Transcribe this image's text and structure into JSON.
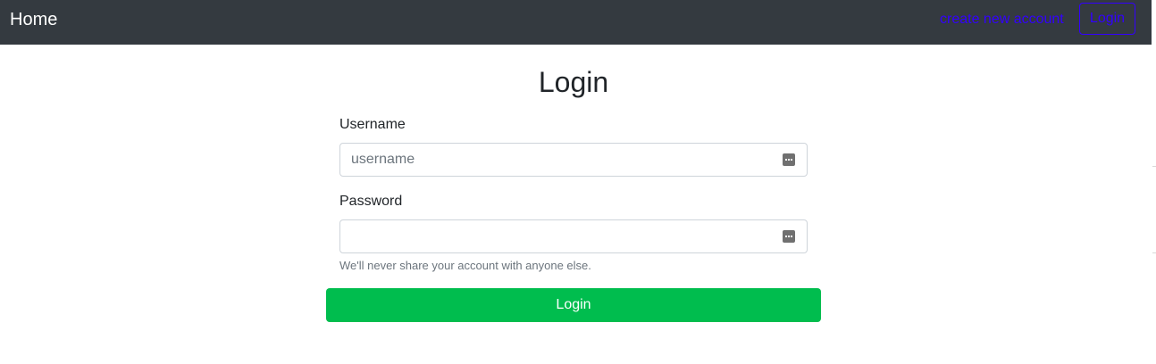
{
  "navbar": {
    "brand": "Home",
    "create_account_link": "create new account",
    "login_button": "Login"
  },
  "form": {
    "title": "Login",
    "username": {
      "label": "Username",
      "placeholder": "username",
      "value": ""
    },
    "password": {
      "label": "Password",
      "placeholder": "",
      "value": ""
    },
    "help_text": "We'll never share your account with anyone else.",
    "submit_label": "Login"
  },
  "colors": {
    "navbar_bg": "#343a40",
    "link": "#3300ff",
    "submit_bg": "#00bd4e"
  },
  "icons": {
    "field_icon": "password-manager-icon"
  }
}
